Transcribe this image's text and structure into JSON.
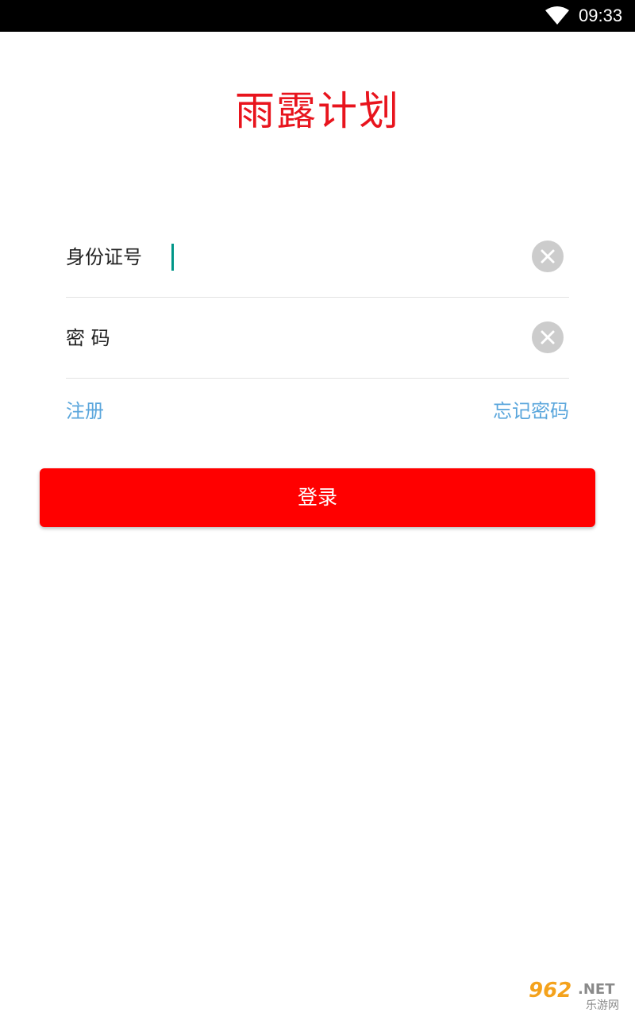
{
  "status_bar": {
    "time": "09:33",
    "wifi_icon": "wifi-icon",
    "background": "#000000"
  },
  "header": {
    "title": "雨露计划",
    "title_color": "#e8141d"
  },
  "form": {
    "id_field": {
      "label": "身份证号",
      "value": "",
      "placeholder": "",
      "clear_icon": "clear-icon"
    },
    "password_field": {
      "label": "密 码",
      "value": "",
      "placeholder": "",
      "clear_icon": "clear-icon"
    }
  },
  "links": {
    "register": "注册",
    "forgot_password": "忘记密码",
    "color": "#5aa6dc"
  },
  "login_button": {
    "label": "登录",
    "color": "#ff0000"
  },
  "watermark": {
    "text": "962.NET 乐游网"
  }
}
